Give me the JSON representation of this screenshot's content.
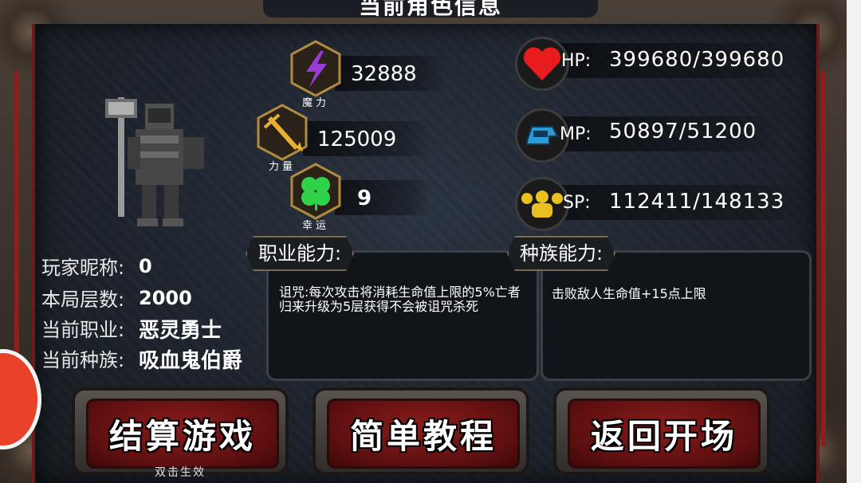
{
  "header": {
    "title": "当前角色信息"
  },
  "player": {
    "nickname_label": "玩家昵称:",
    "nickname": "0",
    "floor_label": "本局层数:",
    "floor": "2000",
    "class_label": "当前职业:",
    "class": "恶灵勇士",
    "race_label": "当前种族:",
    "race": "吸血鬼伯爵"
  },
  "stats": {
    "magic": {
      "label": "魔力",
      "value": "32888",
      "icon": "lightning-icon",
      "color": "#9b3bd6"
    },
    "strength": {
      "label": "力量",
      "value": "125009",
      "icon": "sword-icon",
      "color": "#e8b030"
    },
    "luck": {
      "label": "幸运",
      "value": "9",
      "icon": "clover-icon",
      "color": "#2fd34a"
    }
  },
  "resources": {
    "hp": {
      "label": "HP:",
      "value": "399680/399680",
      "icon": "heart-icon",
      "color": "#e81c1c"
    },
    "mp": {
      "label": "MP:",
      "value": "50897/51200",
      "icon": "mana-icon",
      "color": "#2a9ad8"
    },
    "sp": {
      "label": "SP:",
      "value": "112411/148133",
      "icon": "muscle-icon",
      "color": "#e8c020"
    }
  },
  "abilities": {
    "class_title": "职业能力:",
    "class_text": "诅咒:每次攻击将消耗生命值上限的5%亡者归来升级为5层获得不会被诅咒杀死",
    "race_title": "种族能力:",
    "race_text": "击败敌人生命值+15点上限"
  },
  "buttons": {
    "settle": "结算游戏",
    "settle_hint": "双击生效",
    "tutorial": "简单教程",
    "back": "返回开场"
  }
}
